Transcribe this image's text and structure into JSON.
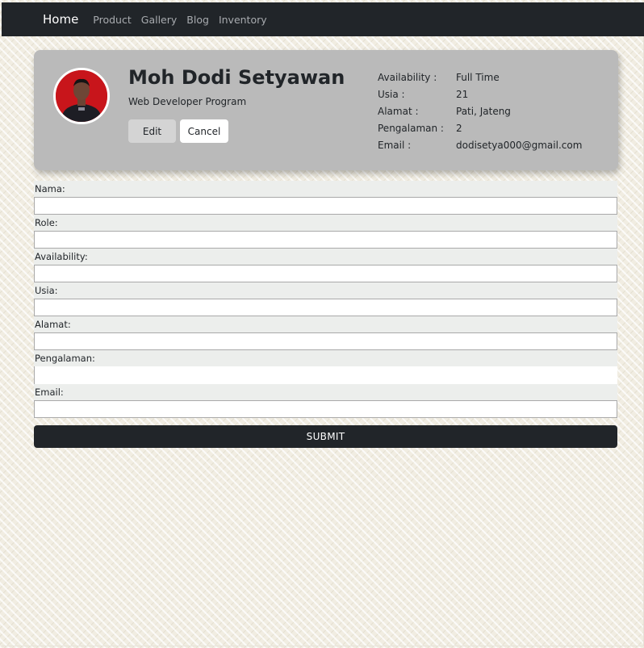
{
  "nav": {
    "brand": "Home",
    "links": [
      "Product",
      "Gallery",
      "Blog",
      "Inventory"
    ]
  },
  "profile": {
    "name": "Moh Dodi Setyawan",
    "role": "Web Developer Program",
    "edit_label": "Edit",
    "cancel_label": "Cancel",
    "details": [
      {
        "key": "Availability :",
        "value": "Full Time"
      },
      {
        "key": "Usia :",
        "value": "21"
      },
      {
        "key": "Alamat :",
        "value": "Pati, Jateng"
      },
      {
        "key": "Pengalaman :",
        "value": "2"
      },
      {
        "key": "Email :",
        "value": "dodisetya000@gmail.com"
      }
    ]
  },
  "form": {
    "fields": [
      {
        "label": "Nama:",
        "value": ""
      },
      {
        "label": "Role:",
        "value": ""
      },
      {
        "label": "Availability:",
        "value": ""
      },
      {
        "label": "Usia:",
        "value": ""
      },
      {
        "label": "Alamat:",
        "value": ""
      },
      {
        "label": "Pengalaman:",
        "value": ""
      },
      {
        "label": "Email:",
        "value": ""
      }
    ],
    "submit_label": "SUBMIT"
  },
  "colors": {
    "navbar": "#212529",
    "card": "#bababa",
    "avatar_bg": "#c8151b"
  }
}
